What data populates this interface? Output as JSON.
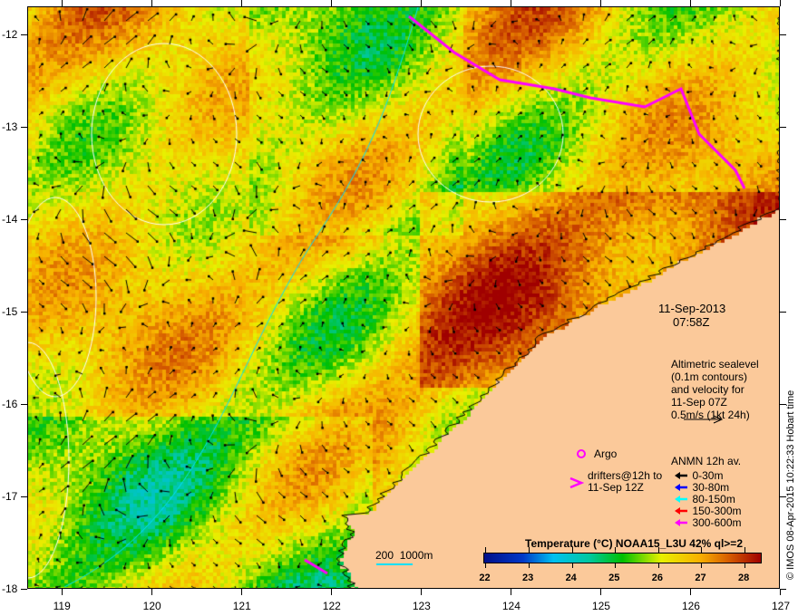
{
  "map": {
    "lon_ticks": [
      119,
      120,
      121,
      122,
      123,
      124,
      125,
      126,
      127
    ],
    "lat_ticks": [
      -12,
      -13,
      -14,
      -15,
      -16,
      -17,
      -18
    ],
    "lon_range": [
      118.62,
      127
    ],
    "lat_range": [
      -11.7,
      -18
    ]
  },
  "annotations": {
    "date": "11-Sep-2013",
    "time": "07:58Z",
    "altimetry_lines": [
      "Altimetric sealevel",
      "(0.1m contours)",
      "and velocity for",
      "11-Sep 07Z",
      "0.5m/s (1kt 24h)"
    ],
    "argo": "Argo",
    "drifters_lines": [
      "drifters@12h to",
      "11-Sep 12Z"
    ],
    "anmn_title": "ANMN 12h av.",
    "anmn_items": [
      {
        "label": "0-30m",
        "color": "#000000"
      },
      {
        "label": "30-80m",
        "color": "#0000ff"
      },
      {
        "label": "80-150m",
        "color": "#00ffff"
      },
      {
        "label": "150-300m",
        "color": "#ff0000"
      },
      {
        "label": "300-600m",
        "color": "#ff00ff"
      }
    ],
    "isobath_label": "200  1000m"
  },
  "colorbar": {
    "title": "Temperature (°C) NOAA15_L3U 42% ql>=2",
    "ticks": [
      22,
      23,
      24,
      25,
      26,
      27,
      28
    ],
    "range": [
      21.95,
      28.4
    ]
  },
  "credit": "© IMOS 08-Apr-2015 10:22:33 Hobart time",
  "colors": {
    "land": "#fbc99a",
    "argo": "#ff00ff",
    "isobath": "#00e0ff"
  }
}
